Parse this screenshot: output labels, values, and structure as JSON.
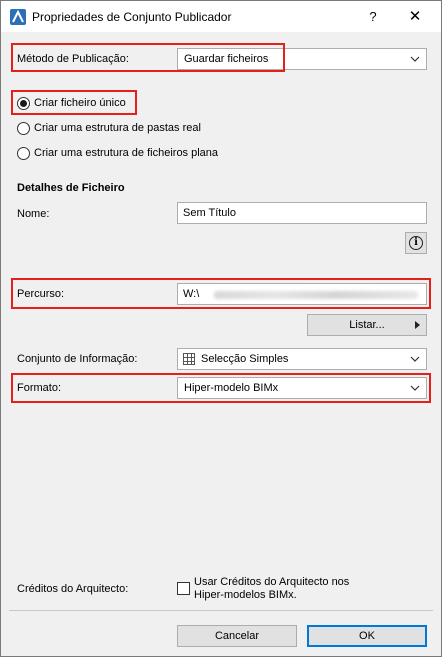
{
  "window": {
    "title": "Propriedades de Conjunto Publicador",
    "help": "?",
    "close": "✕"
  },
  "publish_method": {
    "label": "Método de Publicação:",
    "value": "Guardar ficheiros"
  },
  "save_options": [
    {
      "label": "Criar ficheiro único",
      "checked": true
    },
    {
      "label": "Criar uma estrutura de pastas real",
      "checked": false
    },
    {
      "label": "Criar uma estrutura de ficheiros plana",
      "checked": false
    }
  ],
  "file_details": {
    "heading": "Detalhes de Ficheiro",
    "name_label": "Nome:",
    "name_value": "Sem Título",
    "path_label": "Percurso:",
    "path_value": "W:\\",
    "browse_label": "Listar..."
  },
  "info_set": {
    "label": "Conjunto de Informação:",
    "value": "Selecção Simples"
  },
  "format": {
    "label": "Formato:",
    "value": "Hiper-modelo BIMx"
  },
  "architect_credits": {
    "label": "Créditos do Arquitecto:",
    "checkbox_line1": "Usar Créditos do Arquitecto nos",
    "checkbox_line2": "Hiper-modelos BIMx.",
    "checked": false
  },
  "footer": {
    "cancel_label": "Cancelar",
    "ok_label": "OK"
  },
  "colors": {
    "highlight": "#e3201b",
    "accent": "#0078d7"
  }
}
